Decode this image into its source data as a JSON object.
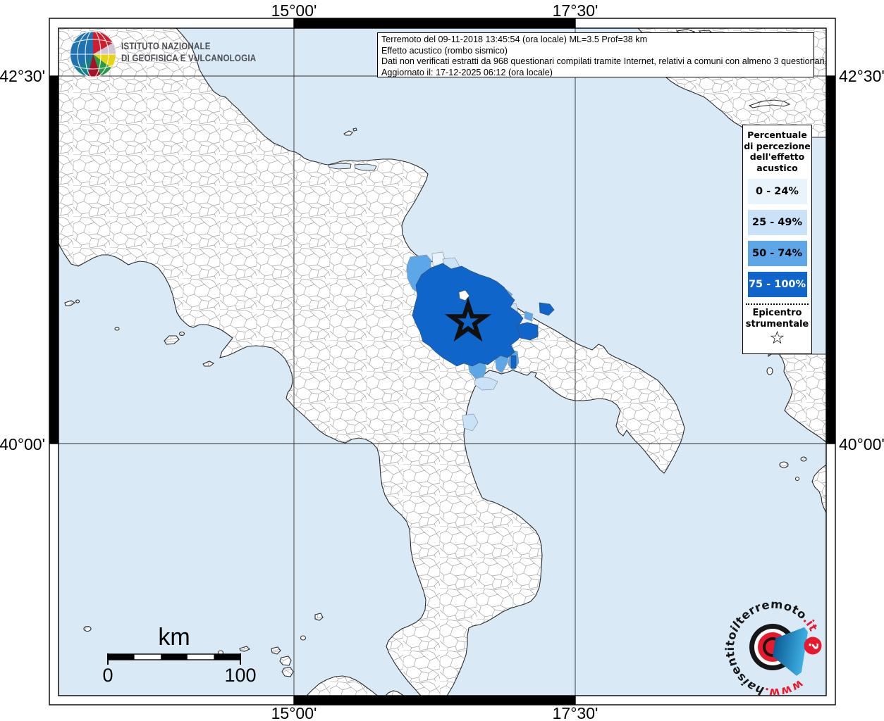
{
  "header": {
    "ingv_line1": "ISTITUTO NAZIONALE",
    "ingv_line2": "DI GEOFISICA E VULCANOLOGIA",
    "info_line1": "Terremoto del 09-11-2018 13:45:54 (ora locale) ML=3.5 Prof=38 km",
    "info_line2": "Effetto acustico (rombo sismico)",
    "info_line3": "Dati non verificati estratti da 968 questionari compilati tramite Internet, relativi a comuni con almeno 3 questionari.",
    "info_line4": "Aggiornato il: 17-12-2025 06:12 (ora locale)"
  },
  "axes": {
    "top": [
      "15°00'",
      "17°30'"
    ],
    "bottom": [
      "15°00'",
      "17°30'"
    ],
    "left": [
      "42°30'",
      "40°00'"
    ],
    "right": [
      "42°30'",
      "40°00'"
    ]
  },
  "legend": {
    "title_lines": [
      "Percentuale",
      "di percezione",
      "dell'effetto",
      "acustico"
    ],
    "classes": [
      {
        "label": "0 - 24%",
        "color": "#e9f3fb"
      },
      {
        "label": "25 - 49%",
        "color": "#c9e2f7"
      },
      {
        "label": "50 - 74%",
        "color": "#5da7e8"
      },
      {
        "label": "75 - 100%",
        "color": "#0f65c9"
      }
    ],
    "epicenter_line1": "Epicentro",
    "epicenter_line2": "strumentale",
    "star_symbol": "☆"
  },
  "scalebar": {
    "unit": "km",
    "start": "0",
    "end": "100"
  },
  "site_logo": {
    "www": "www.",
    "hai": "hai",
    "sentito": "sentito",
    "il": "il",
    "terremoto": "terremoto",
    "it": ".it",
    "question": "?",
    "red": "#e8192c",
    "black": "#161616"
  },
  "map": {
    "colors": {
      "sea": "#d9eaf6",
      "border_gray": "#9b9b9b",
      "coast": "#2b2b2b",
      "c0_24": "#e9f3fb",
      "c25_49": "#c9e2f7",
      "c50_74": "#5da7e8",
      "c75_100": "#0f65c9"
    },
    "epicenter_symbol": "star-outline"
  }
}
